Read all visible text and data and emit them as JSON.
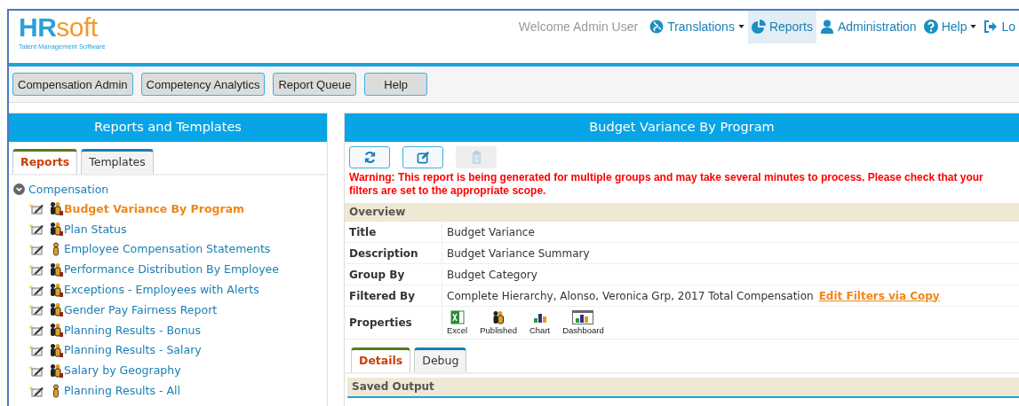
{
  "logo": {
    "primary": "HR",
    "secondary": "soft",
    "tagline": "Talent Management Software"
  },
  "welcome": "Welcome Admin User",
  "nav": [
    {
      "label": "Translations",
      "kind": "globe",
      "dropdown": true,
      "selected": false
    },
    {
      "label": "Reports",
      "kind": "pie",
      "dropdown": false,
      "selected": true
    },
    {
      "label": "Administration",
      "kind": "user",
      "dropdown": false,
      "selected": false
    },
    {
      "label": "Help",
      "kind": "question",
      "dropdown": true,
      "selected": false
    },
    {
      "label": "Lo",
      "kind": "logout",
      "dropdown": false,
      "selected": false
    }
  ],
  "toolbar": [
    "Compensation Admin",
    "Competency Analytics",
    "Report Queue",
    "Help"
  ],
  "left_panel": {
    "title": "Reports and Templates",
    "tabs": [
      {
        "label": "Reports",
        "selected": true
      },
      {
        "label": "Templates",
        "selected": false
      }
    ],
    "tree": [
      {
        "label": "Compensation",
        "expanded": true,
        "children": [
          {
            "label": "Budget Variance By Program",
            "kind": "group",
            "selected": true
          },
          {
            "label": "Plan Status",
            "kind": "group",
            "selected": false
          },
          {
            "label": "Employee Compensation Statements",
            "kind": "single",
            "selected": false
          },
          {
            "label": "Performance Distribution By Employee",
            "kind": "group",
            "selected": false
          },
          {
            "label": "Exceptions - Employees with Alerts",
            "kind": "group",
            "selected": false
          },
          {
            "label": "Gender Pay Fairness Report",
            "kind": "group",
            "selected": false
          },
          {
            "label": "Planning Results - Bonus",
            "kind": "group",
            "selected": false
          },
          {
            "label": "Planning Results - Salary",
            "kind": "group",
            "selected": false
          },
          {
            "label": "Salary by Geography",
            "kind": "group",
            "selected": false
          },
          {
            "label": "Planning Results - All",
            "kind": "single",
            "selected": false
          }
        ]
      }
    ]
  },
  "right_panel": {
    "title": "Budget Variance By Program",
    "actions": [
      {
        "kind": "refresh",
        "disabled": false
      },
      {
        "kind": "edit",
        "disabled": false
      },
      {
        "kind": "delete",
        "disabled": true
      }
    ],
    "warning": "Warning: This report is being generated for multiple groups and may take several minutes to process. Please check that your filters are set to the appropriate scope.",
    "overview": {
      "heading": "Overview",
      "rows": [
        {
          "label": "Title",
          "value": "Budget Variance"
        },
        {
          "label": "Description",
          "value": "Budget Variance Summary"
        },
        {
          "label": "Group By",
          "value": "Budget Category"
        },
        {
          "label": "Filtered By",
          "value": "Complete Hierarchy, Alonso, Veronica Grp, 2017 Total Compensation",
          "link": "Edit Filters via Copy"
        }
      ],
      "properties": {
        "label": "Properties",
        "items": [
          {
            "kind": "excel",
            "label": "Excel"
          },
          {
            "kind": "published",
            "label": "Published"
          },
          {
            "kind": "chart",
            "label": "Chart"
          },
          {
            "kind": "dashboard",
            "label": "Dashboard"
          }
        ]
      }
    },
    "tabs": [
      {
        "label": "Details",
        "selected": true
      },
      {
        "label": "Debug",
        "selected": false
      }
    ],
    "saved_output": {
      "heading": "Saved Output"
    }
  }
}
